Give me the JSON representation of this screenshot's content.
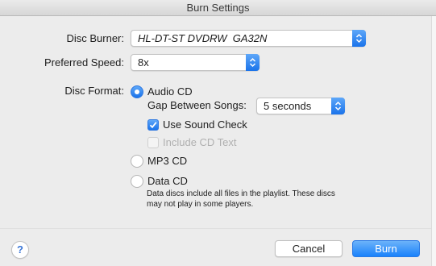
{
  "window": {
    "title": "Burn Settings"
  },
  "disc_burner": {
    "label": "Disc Burner:",
    "value": "HL-DT-ST DVDRW  GA32N"
  },
  "preferred_speed": {
    "label": "Preferred Speed:",
    "value": "8x"
  },
  "disc_format": {
    "label": "Disc Format:",
    "options": [
      {
        "label": "Audio CD",
        "selected": true
      },
      {
        "label": "MP3 CD",
        "selected": false
      },
      {
        "label": "Data CD",
        "selected": false
      }
    ],
    "gap_label": "Gap Between Songs:",
    "gap_value": "5 seconds",
    "use_sound_check": {
      "label": "Use Sound Check",
      "checked": true
    },
    "include_cd_text": {
      "label": "Include CD Text",
      "checked": false,
      "disabled": true
    },
    "data_cd_note": "Data discs include all files in the playlist. These discs may not play in some players."
  },
  "footer": {
    "help_label": "?",
    "cancel_label": "Cancel",
    "burn_label": "Burn"
  },
  "colors": {
    "accent": "#1a82fb",
    "window_bg": "#ececec"
  }
}
